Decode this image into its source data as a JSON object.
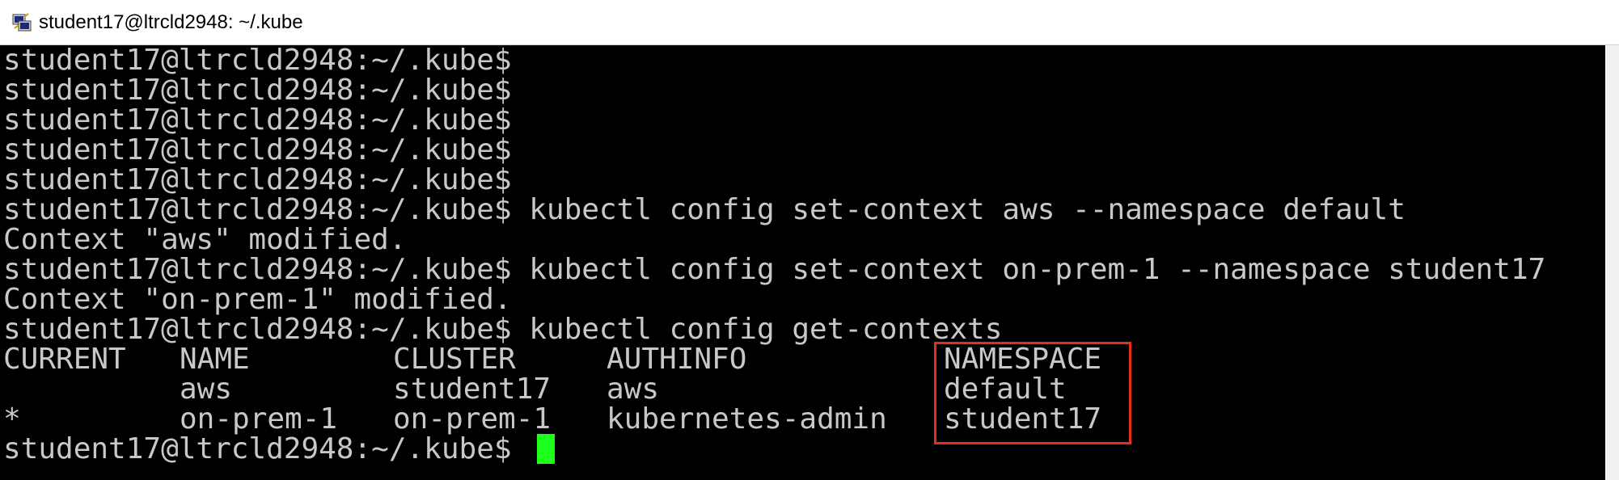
{
  "window": {
    "title": "student17@ltrcld2948: ~/.kube",
    "icon": "putty-terminal-icon"
  },
  "terminal": {
    "prompt": "student17@ltrcld2948:~/.kube$",
    "lines": [
      "student17@ltrcld2948:~/.kube$",
      "student17@ltrcld2948:~/.kube$",
      "student17@ltrcld2948:~/.kube$",
      "student17@ltrcld2948:~/.kube$",
      "student17@ltrcld2948:~/.kube$",
      "student17@ltrcld2948:~/.kube$ kubectl config set-context aws --namespace default",
      "Context \"aws\" modified.",
      "student17@ltrcld2948:~/.kube$ kubectl config set-context on-prem-1 --namespace student17",
      "Context \"on-prem-1\" modified.",
      "student17@ltrcld2948:~/.kube$ kubectl config get-contexts"
    ],
    "contexts_table": {
      "headers": [
        "CURRENT",
        "NAME",
        "CLUSTER",
        "AUTHINFO",
        "NAMESPACE"
      ],
      "rows": [
        [
          "",
          "aws",
          "student17",
          "aws",
          "default"
        ],
        [
          "*",
          "on-prem-1",
          "on-prem-1",
          "kubernetes-admin",
          "student17"
        ]
      ]
    },
    "final_prompt": "student17@ltrcld2948:~/.kube$",
    "cursor_color": "#1cff1c",
    "text_color": "#c8c8c8",
    "background_color": "#000000",
    "highlight_color": "#e62e1b"
  }
}
